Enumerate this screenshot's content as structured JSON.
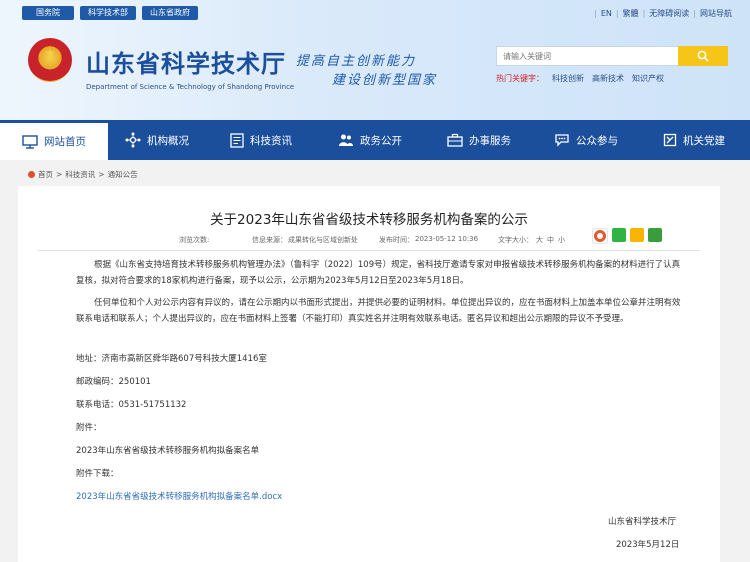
{
  "header": {
    "top_links": [
      "国务院",
      "科学技术部",
      "山东省政府"
    ],
    "right_links": [
      "EN",
      "繁體",
      "无障碍阅读",
      "网站导航"
    ],
    "title": "山东省科学技术厅",
    "subtitle": "Department of Science & Technology of Shandong Province",
    "slogan_line1": "提高自主创新能力",
    "slogan_line2": "建设创新型国家",
    "search_placeholder": "请输入关键词",
    "hot_label": "热门关键字：",
    "hot_keywords": [
      "科技创新",
      "高新技术",
      "知识产权"
    ]
  },
  "nav": {
    "items": [
      {
        "label": "网站首页",
        "icon": "monitor-icon"
      },
      {
        "label": "机构概况",
        "icon": "network-icon"
      },
      {
        "label": "科技资讯",
        "icon": "news-icon"
      },
      {
        "label": "政务公开",
        "icon": "people-icon"
      },
      {
        "label": "办事服务",
        "icon": "briefcase-icon"
      },
      {
        "label": "公众参与",
        "icon": "chat-icon"
      },
      {
        "label": "机关党建",
        "icon": "flag-icon"
      }
    ]
  },
  "breadcrumb": [
    "首页",
    "科技资讯",
    "通知公告"
  ],
  "article": {
    "title": "关于2023年山东省省级技术转移服务机构备案的公示",
    "views_label": "浏览次数:",
    "source_label": "信息来源：",
    "source": "成果转化与区域创新处",
    "date_label": "发布时间：",
    "date": "2023-05-12 10:36",
    "size_label": "文字大小：",
    "size_options": [
      "大",
      "中",
      "小"
    ],
    "para1": "根据《山东省支持培育技术转移服务机构管理办法》（鲁科字〔2022〕109号）规定，省科技厅邀请专家对申报省级技术转移服务机构备案的材料进行了认真复核，拟对符合要求的18家机构进行备案，现予以公示，公示期为2023年5月12日至2023年5月18日。",
    "para2": "任何单位和个人对公示内容有异议的，请在公示期内以书面形式提出，并提供必要的证明材料。单位提出异议的，应在书面材料上加盖本单位公章并注明有效联系电话和联系人；个人提出异议的，应在书面材料上签署（不能打印）真实姓名并注明有效联系电话。匿名异议和超出公示期限的异议不予受理。",
    "address": "地址：济南市高新区舜华路607号科技大厦1416室",
    "postcode": "邮政编码：250101",
    "phone": "联系电话：0531-51751132",
    "attachment_label": "附件：",
    "attachment_name": "2023年山东省省级技术转移服务机构拟备案名单",
    "download_label": "附件下载：",
    "download_link": "2023年山东省省级技术转移服务机构拟备案名单.docx",
    "signature": "山东省科学技术厅",
    "sign_date": "2023年5月12日"
  },
  "colors": {
    "nav_bg": "#1b4f9c",
    "search_btn": "#f5c518",
    "hot_label": "#d2232a",
    "link": "#2f6fb8"
  }
}
